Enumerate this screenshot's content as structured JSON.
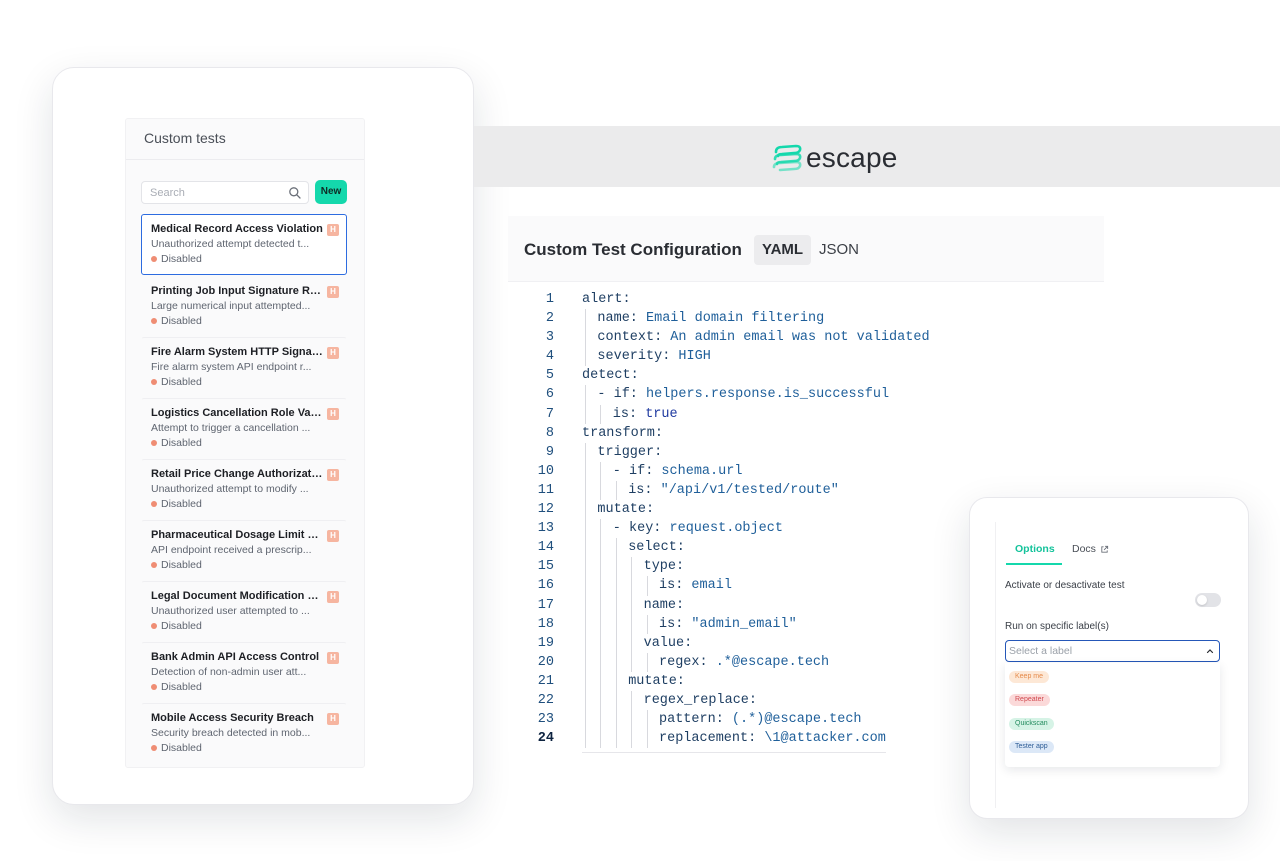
{
  "custom_tests": {
    "title": "Custom tests",
    "search_placeholder": "Search",
    "new_label": "New",
    "items": [
      {
        "name": "Medical Record Access Violation",
        "badge": "H",
        "description": "Unauthorized attempt detected t...",
        "status": "Disabled"
      },
      {
        "name": "Printing Job Input Signature Req...",
        "badge": "H",
        "description": "Large numerical input attempted...",
        "status": "Disabled"
      },
      {
        "name": "Fire Alarm System HTTP Signat...",
        "badge": "H",
        "description": "Fire alarm system API endpoint r...",
        "status": "Disabled"
      },
      {
        "name": "Logistics Cancellation Role Vali...",
        "badge": "H",
        "description": "Attempt to trigger a cancellation ...",
        "status": "Disabled"
      },
      {
        "name": "Retail Price Change Authorization",
        "badge": "H",
        "description": "Unauthorized attempt to modify ...",
        "status": "Disabled"
      },
      {
        "name": "Pharmaceutical Dosage Limit En...",
        "badge": "H",
        "description": "API endpoint received a prescrip...",
        "status": "Disabled"
      },
      {
        "name": "Legal Document Modification M...",
        "badge": "H",
        "description": "Unauthorized user attempted to ...",
        "status": "Disabled"
      },
      {
        "name": "Bank Admin API Access Control",
        "badge": "H",
        "description": "Detection of non-admin user att...",
        "status": "Disabled"
      },
      {
        "name": "Mobile Access Security Breach",
        "badge": "H",
        "description": "Security breach detected in mob...",
        "status": "Disabled"
      }
    ]
  },
  "brand": {
    "name": "escape",
    "accent": "#14d8ac"
  },
  "editor": {
    "title": "Custom Test Configuration",
    "tabs": [
      "YAML",
      "JSON"
    ],
    "active_tab": "YAML",
    "lines": [
      {
        "n": "1",
        "key": "alert:",
        "value": ""
      },
      {
        "n": "2",
        "key": "name:",
        "value": " Email domain filtering"
      },
      {
        "n": "3",
        "key": "context:",
        "value": " An admin email was not validated"
      },
      {
        "n": "4",
        "key": "severity:",
        "value": " HIGH"
      },
      {
        "n": "5",
        "key": "detect:",
        "value": ""
      },
      {
        "n": "6",
        "key": "- if:",
        "value": " helpers.response.is_successful"
      },
      {
        "n": "7",
        "key": "is:",
        "value": " true"
      },
      {
        "n": "8",
        "key": "transform:",
        "value": ""
      },
      {
        "n": "9",
        "key": "trigger:",
        "value": ""
      },
      {
        "n": "10",
        "key": "- if:",
        "value": " schema.url"
      },
      {
        "n": "11",
        "key": "is:",
        "value": " \"/api/v1/tested/route\""
      },
      {
        "n": "12",
        "key": "mutate:",
        "value": ""
      },
      {
        "n": "13",
        "key": "- key:",
        "value": " request.object"
      },
      {
        "n": "14",
        "key": "select:",
        "value": ""
      },
      {
        "n": "15",
        "key": "type:",
        "value": ""
      },
      {
        "n": "16",
        "key": "is:",
        "value": " email"
      },
      {
        "n": "17",
        "key": "name:",
        "value": ""
      },
      {
        "n": "18",
        "key": "is:",
        "value": " \"admin_email\""
      },
      {
        "n": "19",
        "key": "value:",
        "value": ""
      },
      {
        "n": "20",
        "key": "regex:",
        "value": " .*@escape.tech"
      },
      {
        "n": "21",
        "key": "mutate:",
        "value": ""
      },
      {
        "n": "22",
        "key": "regex_replace:",
        "value": ""
      },
      {
        "n": "23",
        "key": "pattern:",
        "value": " (.*)@escape.tech"
      },
      {
        "n": "24",
        "key": "replacement:",
        "value": " \\1@attacker.com"
      }
    ]
  },
  "options_panel": {
    "tabs": {
      "options": "Options",
      "docs": "Docs"
    },
    "activate_label": "Activate or desactivate test",
    "toggle_on": false,
    "labels_label": "Run on specific label(s)",
    "select_placeholder": "Select a label",
    "label_options": [
      {
        "name": "Keep me",
        "bg": "#fde8d6",
        "fg": "#e58a4a"
      },
      {
        "name": "Repeater",
        "bg": "#fbd9d9",
        "fg": "#d0494f"
      },
      {
        "name": "Quickscan",
        "bg": "#d6f3e6",
        "fg": "#218a5d"
      },
      {
        "name": "Tester app",
        "bg": "#dce8f7",
        "fg": "#2e5d96"
      }
    ]
  }
}
